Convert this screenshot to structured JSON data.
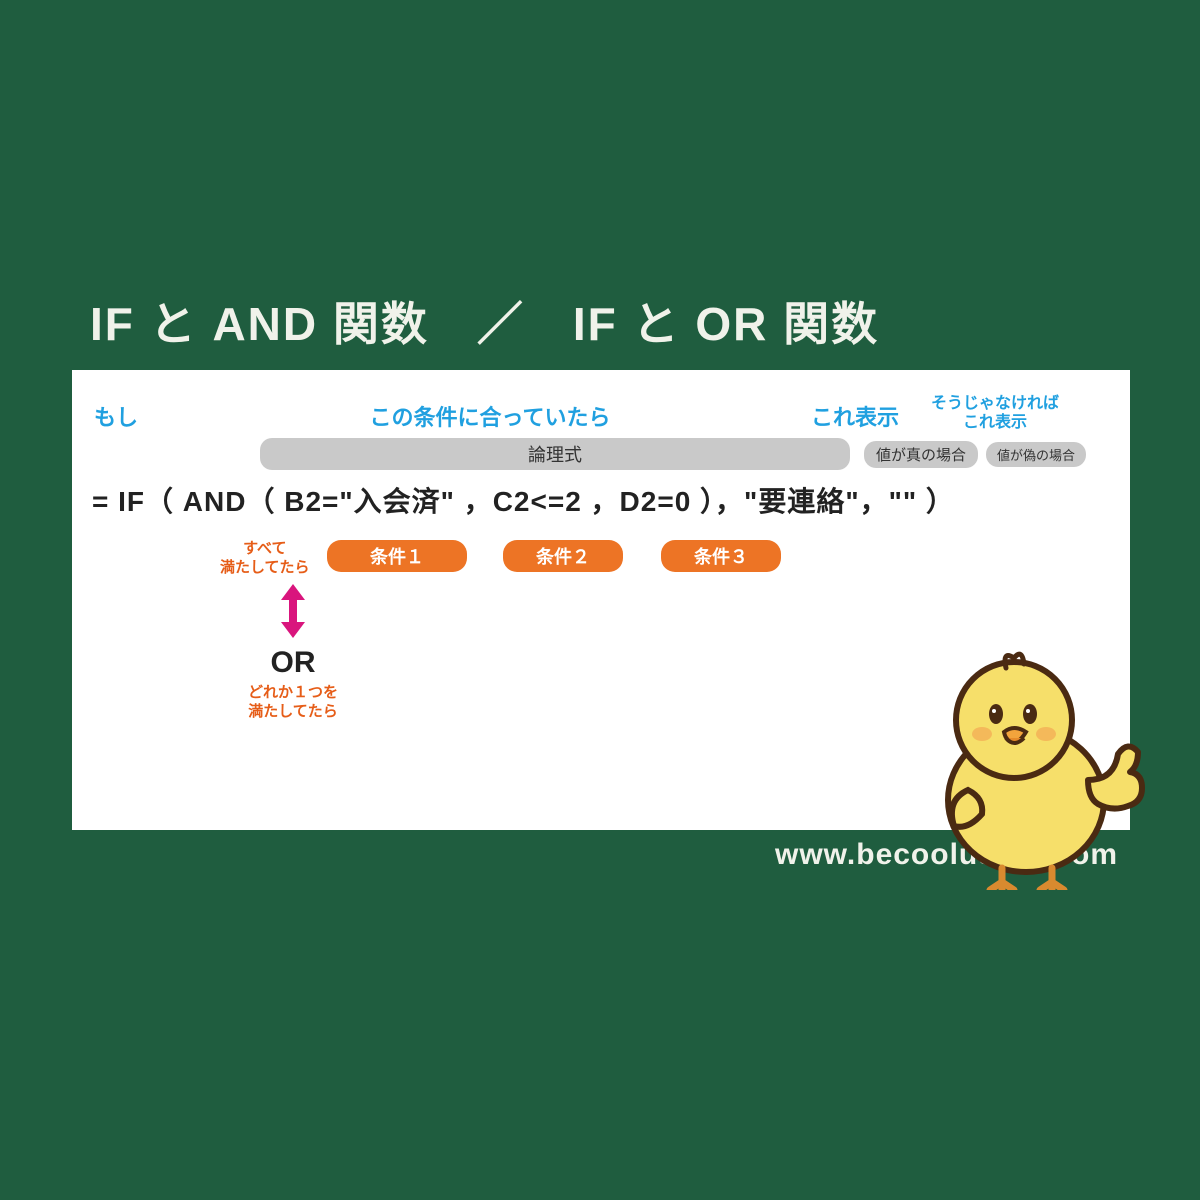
{
  "title": "IF と AND 関数　／　IF と OR 関数",
  "headers": {
    "moshi": "もし",
    "cond": "この条件に合っていたら",
    "true": "これ表示",
    "false": "そうじゃなければ\nこれ表示"
  },
  "pills": {
    "logic": "論理式",
    "true": "値が真の場合",
    "false": "値が偽の場合"
  },
  "formula": "= IF（ AND（ B2=\"入会済\" ，C2<=2 ，D2=0 ），\"要連絡\"，\"\" ）",
  "notes": {
    "subete": "すべて\n満たしてたら",
    "doreka": "どれか１つを\n満たしてたら"
  },
  "cond_labels": {
    "c1": "条件１",
    "c2": "条件２",
    "c3": "条件３"
  },
  "or_text": "OR",
  "url": "www.becoolusers.com"
}
